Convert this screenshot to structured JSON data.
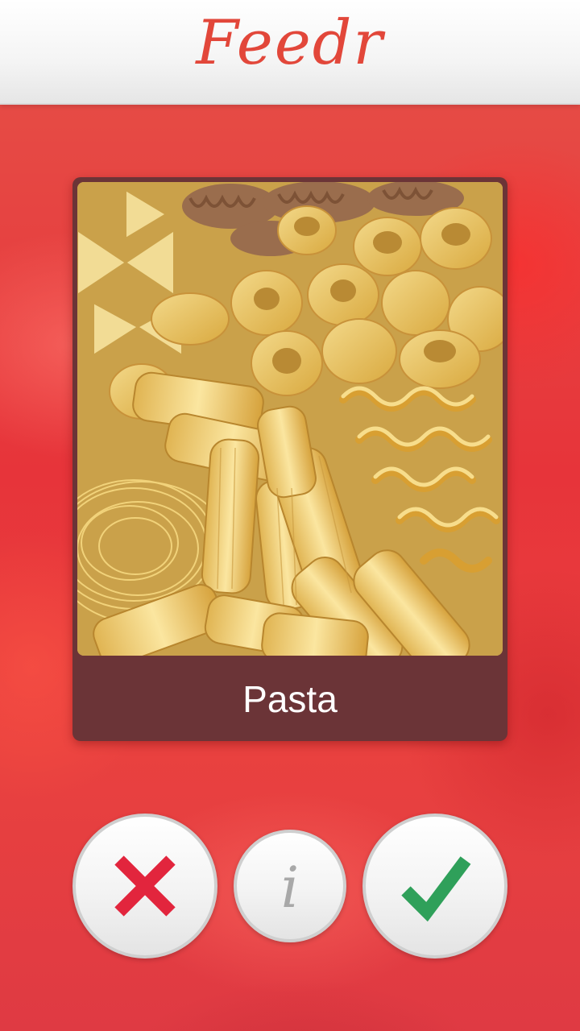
{
  "app": {
    "title": "Feedr"
  },
  "card": {
    "caption": "Pasta",
    "image_description_icon": "pasta-photo"
  },
  "actions": {
    "reject_icon": "close-icon",
    "info_label": "i",
    "accept_icon": "checkmark-icon"
  },
  "colors": {
    "brand": "#e2473a",
    "background": "#e23a36",
    "card": "#6b3437",
    "reject": "#e2253d",
    "accept": "#2fa05a",
    "info": "#a8a8a8"
  }
}
